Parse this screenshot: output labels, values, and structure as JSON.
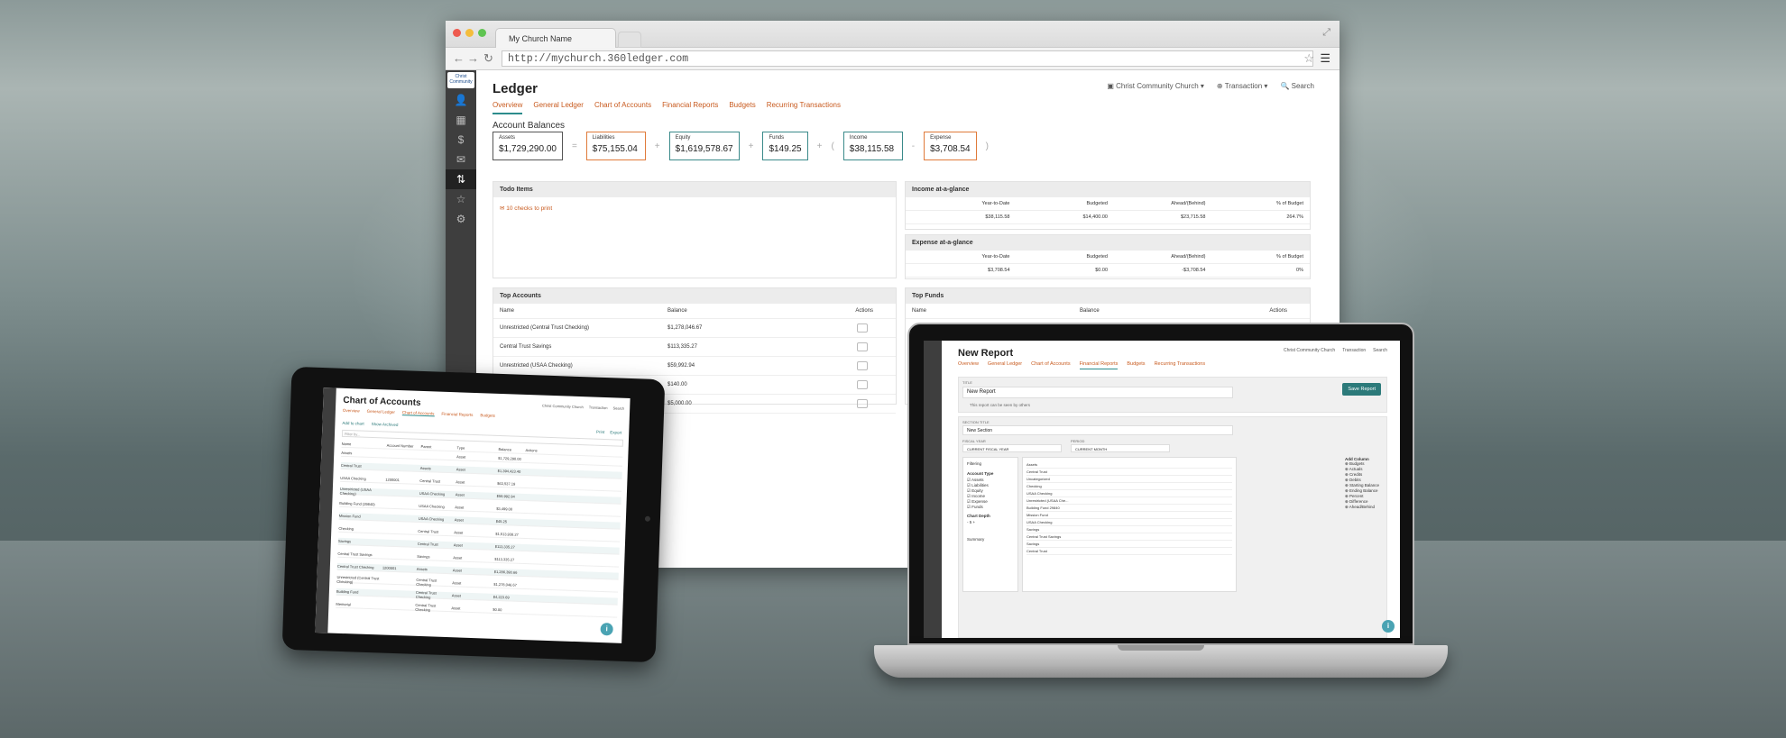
{
  "browser": {
    "tab_title": "My Church Name",
    "url": "http://mychurch.360ledger.com",
    "logo_text": "Christ Community"
  },
  "ledger": {
    "page_title": "Ledger",
    "org": "Christ Community Church",
    "transaction": "Transaction",
    "search": "Search",
    "tabs": [
      "Overview",
      "General Ledger",
      "Chart of Accounts",
      "Financial Reports",
      "Budgets",
      "Recurring Transactions"
    ],
    "section_title": "Account Balances",
    "balances": [
      {
        "label": "Assets",
        "value": "$1,729,290.00"
      },
      {
        "label": "Liabilities",
        "value": "$75,155.04"
      },
      {
        "label": "Equity",
        "value": "$1,619,578.67"
      },
      {
        "label": "Funds",
        "value": "$149.25"
      },
      {
        "label": "Income",
        "value": "$38,115.58"
      },
      {
        "label": "Expense",
        "value": "$3,708.54"
      }
    ],
    "operators": [
      "=",
      "+",
      "+",
      "+",
      "(",
      "-",
      ")"
    ],
    "todo_title": "Todo Items",
    "todo_item": "10 checks to print",
    "income_title": "Income at-a-glance",
    "expense_title": "Expense at-a-glance",
    "glance_headers": [
      "Year-to-Date",
      "Budgeted",
      "Ahead/(Behind)",
      "% of Budget"
    ],
    "income_values": [
      "$38,115.58",
      "$14,400.00",
      "$23,715.58",
      "264.7%"
    ],
    "expense_values": [
      "$3,708.54",
      "$0.00",
      "-$3,708.54",
      "0%"
    ],
    "top_accounts_title": "Top Accounts",
    "top_funds_title": "Top Funds",
    "col_name": "Name",
    "col_balance": "Balance",
    "col_actions": "Actions",
    "accounts": [
      {
        "name": "Unrestricted (Central Trust Checking)",
        "balance": "$1,278,046.67"
      },
      {
        "name": "Central Trust Savings",
        "balance": "$113,335.27"
      },
      {
        "name": "Unrestricted (USAA Checking)",
        "balance": "$59,992.94"
      },
      {
        "name": "",
        "balance": "$140.00"
      },
      {
        "name": "",
        "balance": "$5,000.00"
      }
    ]
  },
  "tablet": {
    "title": "Chart of Accounts",
    "org": "Christ Community Church",
    "transaction": "Transaction",
    "search": "Search",
    "tabs": [
      "Overview",
      "General Ledger",
      "Chart of Accounts",
      "Financial Reports",
      "Budgets"
    ],
    "add_chart": "Add to chart",
    "show_archived": "Show Archived",
    "print": "Print",
    "export": "Export",
    "filter_placeholder": "Filter by...",
    "headers": [
      "Name",
      "Account Number",
      "Parent",
      "Type",
      "Balance",
      "Actions"
    ],
    "rows": [
      {
        "name": "Assets",
        "num": "",
        "parent": "",
        "type": "Asset",
        "bal": "$1,729,290.00"
      },
      {
        "name": "Central Trust",
        "num": "",
        "parent": "Assets",
        "type": "Asset",
        "bal": "$1,394,423.40"
      },
      {
        "name": "USAA Checking",
        "num": "1200001",
        "parent": "Central Trust",
        "type": "Asset",
        "bal": "$63,537.19"
      },
      {
        "name": "Unrestricted (USAA Checking)",
        "num": "",
        "parent": "USAA Checking",
        "type": "Asset",
        "bal": "$59,992.94"
      },
      {
        "name": "Building Fund (29840)",
        "num": "",
        "parent": "USAA Checking",
        "type": "Asset",
        "bal": "$3,499.00"
      },
      {
        "name": "Mission Fund",
        "num": "",
        "parent": "USAA Checking",
        "type": "Asset",
        "bal": "$45.25"
      },
      {
        "name": "Checking",
        "num": "",
        "parent": "Central Trust",
        "type": "Asset",
        "bal": "$1,513,938.27"
      },
      {
        "name": "Savings",
        "num": "",
        "parent": "Central Trust",
        "type": "Asset",
        "bal": "$113,335.27"
      },
      {
        "name": "Central Trust Savings",
        "num": "",
        "parent": "Savings",
        "type": "Asset",
        "bal": "$113,335.27"
      },
      {
        "name": "Central Trust Checking",
        "num": "1200001",
        "parent": "Assets",
        "type": "Asset",
        "bal": "$1,286,390.66"
      },
      {
        "name": "Unrestricted (Central Trust Checking)",
        "num": "",
        "parent": "Central Trust Checking",
        "type": "Asset",
        "bal": "$1,278,046.67"
      },
      {
        "name": "Building Fund",
        "num": "",
        "parent": "Central Trust Checking",
        "type": "Asset",
        "bal": "$4,223.69"
      },
      {
        "name": "Memorial",
        "num": "",
        "parent": "Central Trust Checking",
        "type": "Asset",
        "bal": "$0.00"
      }
    ]
  },
  "laptop": {
    "title": "New Report",
    "org": "Christ Community Church",
    "transaction": "Transaction",
    "search": "Search",
    "tabs": [
      "Overview",
      "General Ledger",
      "Chart of Accounts",
      "Financial Reports",
      "Budgets",
      "Recurring Transactions"
    ],
    "title_label": "TITLE",
    "title_value": "New Report",
    "save_button": "Save Report",
    "shared_note": "This report can be seen by others",
    "section_title_label": "SECTION TITLE",
    "section_title_value": "New Section",
    "fiscal_year_label": "FISCAL YEAR",
    "fiscal_year_value": "CURRENT FISCAL YEAR",
    "period_label": "PERIOD",
    "period_value": "CURRENT MONTH",
    "filtering": "Filtering",
    "account_type": "Account Type",
    "account_types": [
      "Assets",
      "Liabilities",
      "Equity",
      "Income",
      "Expense",
      "Funds"
    ],
    "chart_depth": "Chart Depth",
    "chart_depth_value": "5",
    "summary": "Summary",
    "tree": [
      "Assets",
      "Central Trust",
      "Uncategorized",
      "Checking",
      "USAA Checking",
      "Unrestricted (USAA Che...",
      "Building Fund 29840",
      "Mission Fund",
      "USAA Checking",
      "Savings",
      "Central Trust Savings",
      "Savings",
      "Central Trust"
    ],
    "add_column": "Add Column",
    "columns": [
      "Budgets",
      "Actuals",
      "Credits",
      "Debits",
      "Starting Balance",
      "Ending Balance",
      "Percent",
      "Difference",
      "Ahead/Behind"
    ]
  }
}
